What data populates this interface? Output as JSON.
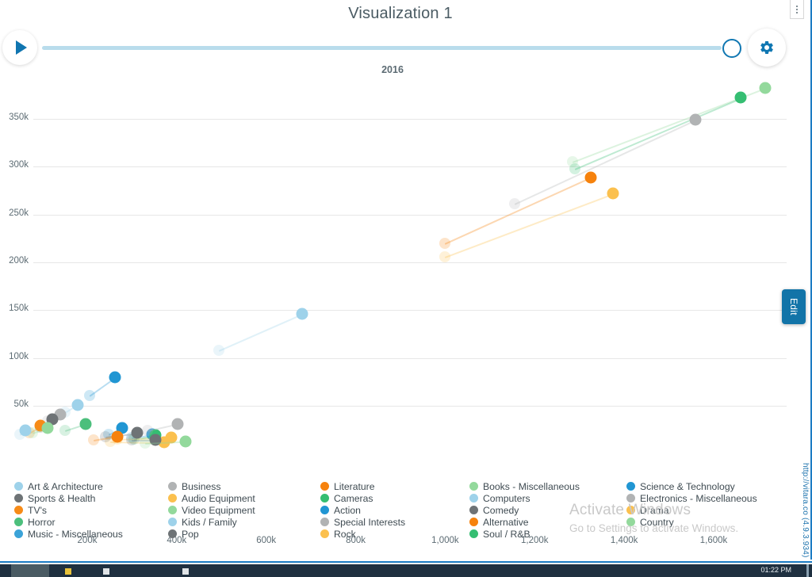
{
  "window": {
    "title": "Visualization 1",
    "kebab_icon": "vertical-dots-icon",
    "edit_label": "Edit",
    "vitara_url": "http://vitara.co (4.9.3.934)"
  },
  "controls": {
    "play_icon": "play-icon",
    "gear_icon": "gear-icon",
    "year_label": "2016",
    "slider_position_pct": 100
  },
  "watermark": {
    "line1": "Activate Windows",
    "line2": "Go to Settings to activate Windows."
  },
  "taskbar": {
    "clock": "01:22 PM"
  },
  "legend": {
    "columns": [
      {
        "x": 18,
        "items": [
          {
            "label": "Art & Architecture",
            "color": "#9ed2ea"
          },
          {
            "label": "Sports & Health",
            "color": "#6e7376"
          },
          {
            "label": "TV's",
            "color": "#f78b17"
          },
          {
            "label": "Horror",
            "color": "#4cbf7c"
          },
          {
            "label": "Music - Miscellaneous",
            "color": "#3ba3d8"
          }
        ]
      },
      {
        "x": 212,
        "items": [
          {
            "label": "Business",
            "color": "#b1b3b4"
          },
          {
            "label": "Audio Equipment",
            "color": "#fbc04e"
          },
          {
            "label": "Video Equipment",
            "color": "#93d99c"
          },
          {
            "label": "Kids / Family",
            "color": "#9ed2ea"
          },
          {
            "label": "Pop",
            "color": "#6e7376"
          }
        ]
      },
      {
        "x": 404,
        "items": [
          {
            "label": "Literature",
            "color": "#f6820d"
          },
          {
            "label": "Cameras",
            "color": "#35be72"
          },
          {
            "label": "Action",
            "color": "#2196d3"
          },
          {
            "label": "Special Interests",
            "color": "#b1b3b4"
          },
          {
            "label": "Rock",
            "color": "#fbc04e"
          }
        ]
      },
      {
        "x": 592,
        "items": [
          {
            "label": "Books - Miscellaneous",
            "color": "#93d99c"
          },
          {
            "label": "Computers",
            "color": "#9ed2ea"
          },
          {
            "label": "Comedy",
            "color": "#6e7376"
          },
          {
            "label": "Alternative",
            "color": "#f6820d"
          },
          {
            "label": "Soul / R&B",
            "color": "#35be72"
          }
        ]
      },
      {
        "x": 790,
        "items": [
          {
            "label": "Science & Technology",
            "color": "#2196d3"
          },
          {
            "label": "Electronics - Miscellaneous",
            "color": "#b1b3b4"
          },
          {
            "label": "Drama",
            "color": "#fbc04e"
          },
          {
            "label": "Country",
            "color": "#93d99c"
          }
        ]
      }
    ]
  },
  "chart_data": {
    "type": "scatter",
    "title": "Visualization 1",
    "subtitle": "2016",
    "xlabel": "",
    "ylabel": "",
    "grid": true,
    "legend_position": "bottom",
    "xlim": [
      0,
      1750000
    ],
    "ylim": [
      0,
      400000
    ],
    "xticks": [
      200000,
      400000,
      600000,
      800000,
      1000000,
      1200000,
      1400000,
      1600000
    ],
    "xtick_labels": [
      "200k",
      "400k",
      "600k",
      "800k",
      "1,000k",
      "1,200k",
      "1,400k",
      "1,600k"
    ],
    "yticks": [
      50000,
      100000,
      150000,
      200000,
      250000,
      300000,
      350000
    ],
    "ytick_labels": [
      "50k",
      "100k",
      "150k",
      "200k",
      "250k",
      "300k",
      "350k"
    ],
    "note": "Animated motion scatter; each series shows a faded trail point (prior frame) connected to the current point.",
    "series": [
      {
        "name": "Country",
        "color": "#93d99c",
        "trail": {
          "x": 1285000,
          "y": 305000
        },
        "point": {
          "x": 1715000,
          "y": 382000
        }
      },
      {
        "name": "Soul / R&B",
        "color": "#35be72",
        "trail": {
          "x": 1290000,
          "y": 298000
        },
        "point": {
          "x": 1660000,
          "y": 372000
        }
      },
      {
        "name": "Electronics - Miscellaneous",
        "color": "#b1b3b4",
        "trail": {
          "x": 1155000,
          "y": 261000
        },
        "point": {
          "x": 1560000,
          "y": 349000
        }
      },
      {
        "name": "Literature",
        "color": "#f6820d",
        "trail": {
          "x": 1000000,
          "y": 220000
        },
        "point": {
          "x": 1325000,
          "y": 289000
        }
      },
      {
        "name": "Drama",
        "color": "#fbc04e",
        "trail": {
          "x": 1000000,
          "y": 206000
        },
        "point": {
          "x": 1375000,
          "y": 272000
        }
      },
      {
        "name": "Computers",
        "color": "#9ed2ea",
        "trail": {
          "x": 495000,
          "y": 108000
        },
        "point": {
          "x": 680000,
          "y": 146000
        }
      },
      {
        "name": "Science & Technology",
        "color": "#2196d3",
        "trail": {
          "x": 205000,
          "y": 61000
        },
        "point": {
          "x": 262000,
          "y": 80000
        }
      },
      {
        "name": "Kids / Family",
        "color": "#9ed2ea",
        "trail": {
          "x": 150000,
          "y": 43000
        },
        "point": {
          "x": 178000,
          "y": 51000
        }
      },
      {
        "name": "Business",
        "color": "#b1b3b4",
        "trail": {
          "x": 112000,
          "y": 34000
        },
        "point": {
          "x": 140000,
          "y": 41000
        }
      },
      {
        "name": "Sports & Health",
        "color": "#6e7376",
        "trail": {
          "x": 95000,
          "y": 28000
        },
        "point": {
          "x": 122000,
          "y": 36000
        }
      },
      {
        "name": "TV's",
        "color": "#f78b17",
        "trail": {
          "x": 70000,
          "y": 22000
        },
        "point": {
          "x": 96000,
          "y": 29000
        }
      },
      {
        "name": "Video Equipment",
        "color": "#93d99c",
        "trail": {
          "x": 78000,
          "y": 22000
        },
        "point": {
          "x": 112000,
          "y": 27000
        }
      },
      {
        "name": "Art & Architecture",
        "color": "#9ed2ea",
        "trail": {
          "x": 50000,
          "y": 20000
        },
        "point": {
          "x": 62000,
          "y": 24000
        }
      },
      {
        "name": "Horror",
        "color": "#4cbf7c",
        "trail": {
          "x": 150000,
          "y": 24000
        },
        "point": {
          "x": 196000,
          "y": 31000
        }
      },
      {
        "name": "Action",
        "color": "#2196d3",
        "trail": {
          "x": 248000,
          "y": 20000
        },
        "point": {
          "x": 278000,
          "y": 27000
        }
      },
      {
        "name": "Music - Miscellaneous",
        "color": "#3ba3d8",
        "trail": {
          "x": 300000,
          "y": 17000
        },
        "point": {
          "x": 345000,
          "y": 20000
        }
      },
      {
        "name": "Cameras",
        "color": "#35be72",
        "trail": {
          "x": 305000,
          "y": 15000
        },
        "point": {
          "x": 352000,
          "y": 19000
        }
      },
      {
        "name": "Rock",
        "color": "#fbc04e",
        "trail": {
          "x": 268000,
          "y": 15000
        },
        "point": {
          "x": 388000,
          "y": 17000
        }
      },
      {
        "name": "Audio Equipment",
        "color": "#fbc04e",
        "trail": {
          "x": 252000,
          "y": 13000
        },
        "point": {
          "x": 372000,
          "y": 12000
        }
      },
      {
        "name": "Pop",
        "color": "#6e7376",
        "trail": {
          "x": 300000,
          "y": 14000
        },
        "point": {
          "x": 352000,
          "y": 14000
        }
      },
      {
        "name": "Comedy",
        "color": "#6e7376",
        "trail": {
          "x": 240000,
          "y": 18000
        },
        "point": {
          "x": 312000,
          "y": 22000
        }
      },
      {
        "name": "Special Interests",
        "color": "#b1b3b4",
        "trail": {
          "x": 335000,
          "y": 24000
        },
        "point": {
          "x": 402000,
          "y": 31000
        }
      },
      {
        "name": "Books - Miscellaneous",
        "color": "#93d99c",
        "trail": {
          "x": 330000,
          "y": 11000
        },
        "point": {
          "x": 420000,
          "y": 13000
        }
      },
      {
        "name": "Alternative",
        "color": "#f6820d",
        "trail": {
          "x": 215000,
          "y": 14000
        },
        "point": {
          "x": 268000,
          "y": 18000
        }
      }
    ]
  }
}
